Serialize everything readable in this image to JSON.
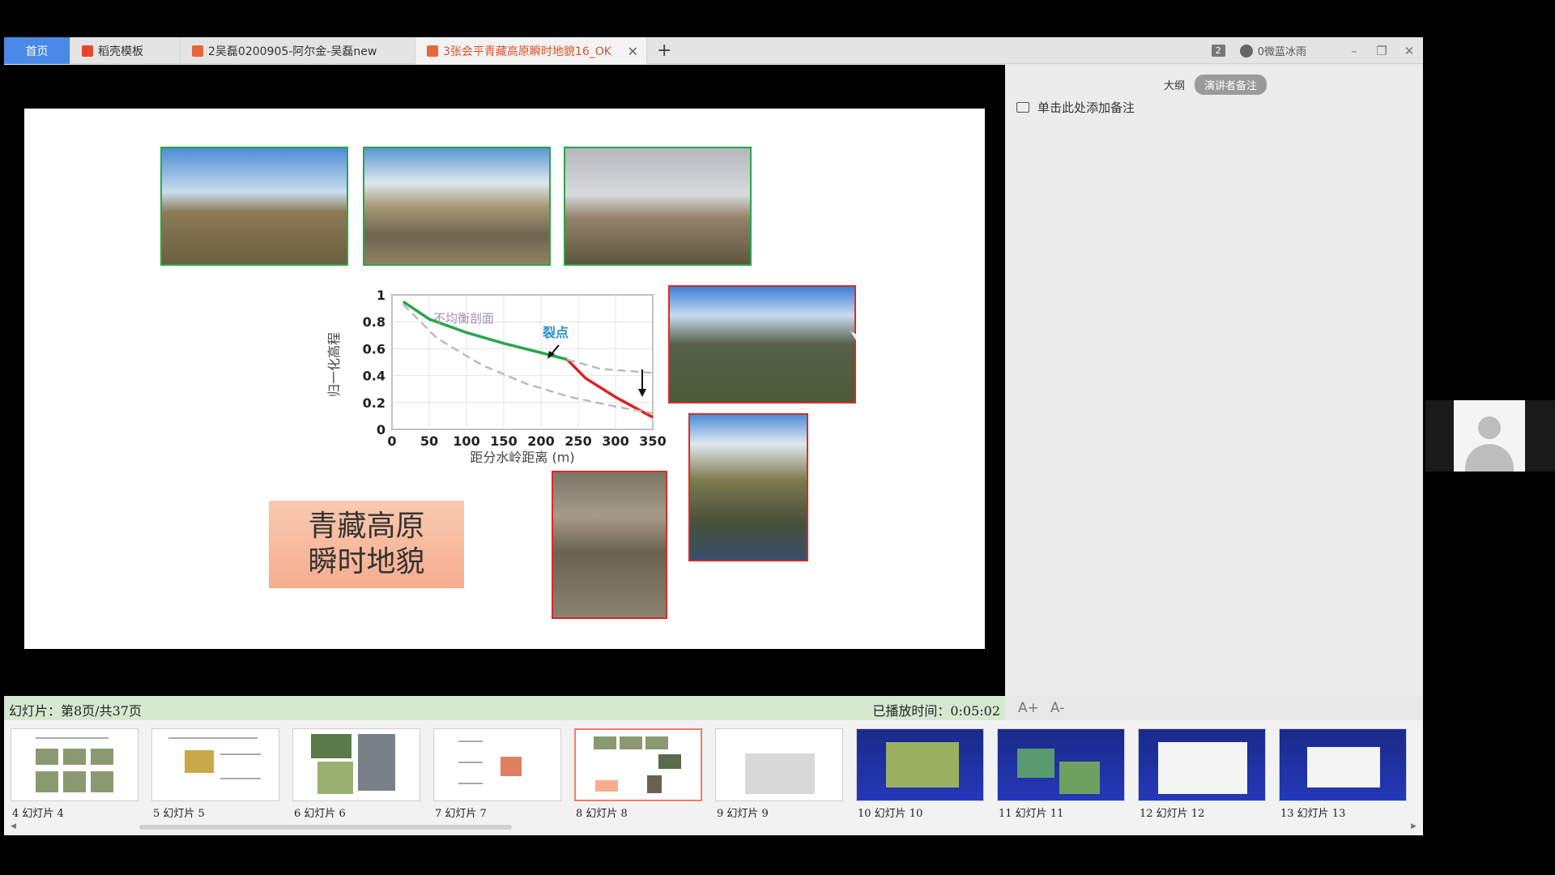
{
  "tabs": [
    {
      "label": "首页"
    },
    {
      "label": "稻壳模板"
    },
    {
      "label": "2吴磊0200905-阿尔金-吴磊new"
    },
    {
      "label": "3张会平青藏高原瞬时地貌16_OK"
    }
  ],
  "window": {
    "count_badge": "2",
    "user_name": "0微蓝冰雨",
    "minimize": "–",
    "restore": "❐",
    "close": "✕",
    "add_tab": "+"
  },
  "notes": {
    "outline_tab": "大纲",
    "notes_tab": "演讲者备注",
    "placeholder": "单击此处添加备注",
    "font_increase": "A+",
    "font_decrease": "A-"
  },
  "status": {
    "slide_info": "幻灯片：第8页/共37页",
    "elapsed": "已播放时间：0:05:02"
  },
  "slide": {
    "title_line1": "青藏高原",
    "title_line2": "瞬时地貌"
  },
  "chart_data": {
    "type": "line",
    "ylabel": "归一化高程",
    "xlabel": "距分水岭距离 (m)",
    "xlim": [
      0,
      350
    ],
    "ylim": [
      0,
      1
    ],
    "x_ticks": [
      "0",
      "50",
      "100",
      "150",
      "200",
      "250",
      "300",
      "350"
    ],
    "y_ticks": [
      "0",
      "0.2",
      "0.4",
      "0.6",
      "0.8",
      "1"
    ],
    "annotations": [
      "不均衡剖面",
      "裂点"
    ],
    "series": [
      {
        "color": "#2aa54a",
        "x": [
          15,
          50,
          100,
          150,
          200,
          235
        ],
        "y": [
          0.95,
          0.82,
          0.72,
          0.64,
          0.57,
          0.52
        ]
      },
      {
        "color": "#e02020",
        "x": [
          235,
          260,
          300,
          350
        ],
        "y": [
          0.52,
          0.38,
          0.24,
          0.09
        ]
      },
      {
        "color": "#bbbbbb",
        "dash": true,
        "x": [
          15,
          60,
          120,
          180,
          240,
          300,
          350
        ],
        "y": [
          0.93,
          0.68,
          0.48,
          0.34,
          0.24,
          0.17,
          0.12
        ]
      },
      {
        "color": "#bbbbbb",
        "dash": true,
        "x": [
          235,
          280,
          350
        ],
        "y": [
          0.52,
          0.45,
          0.42
        ]
      }
    ]
  },
  "thumbnails": [
    {
      "label": "4  幻灯片  4"
    },
    {
      "label": "5  幻灯片  5"
    },
    {
      "label": "6  幻灯片  6"
    },
    {
      "label": "7  幻灯片  7"
    },
    {
      "label": "8  幻灯片  8"
    },
    {
      "label": "9  幻灯片  9"
    },
    {
      "label": "10 幻灯片  10"
    },
    {
      "label": "11 幻灯片  11"
    },
    {
      "label": "12 幻灯片  12"
    },
    {
      "label": "13 幻灯片  13"
    }
  ]
}
